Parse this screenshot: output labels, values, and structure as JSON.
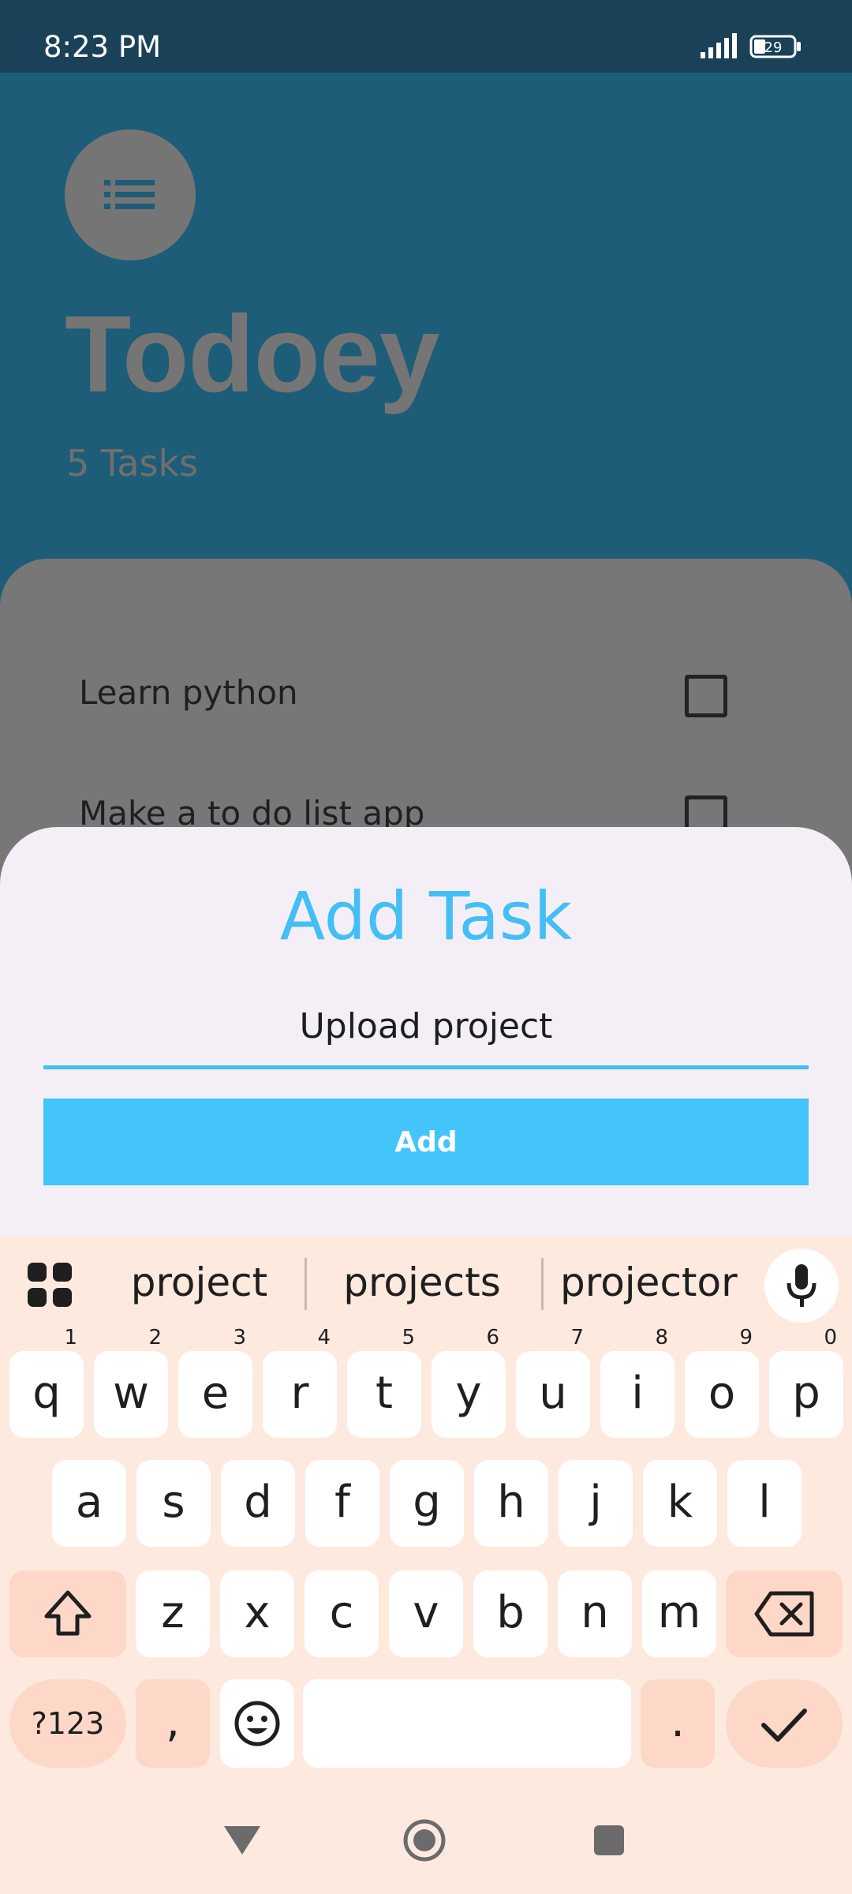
{
  "status_bar": {
    "time": "8:23 PM",
    "battery": "29"
  },
  "app": {
    "title": "Todoey",
    "task_count": "5 Tasks",
    "tasks": [
      "Learn python",
      "Make a to do list app"
    ]
  },
  "sheet": {
    "title": "Add Task",
    "input_value": "Upload project",
    "add_button": "Add"
  },
  "keyboard": {
    "suggestions": [
      "project",
      "projects",
      "projector"
    ],
    "row1": [
      {
        "k": "q",
        "h": "1"
      },
      {
        "k": "w",
        "h": "2"
      },
      {
        "k": "e",
        "h": "3"
      },
      {
        "k": "r",
        "h": "4"
      },
      {
        "k": "t",
        "h": "5"
      },
      {
        "k": "y",
        "h": "6"
      },
      {
        "k": "u",
        "h": "7"
      },
      {
        "k": "i",
        "h": "8"
      },
      {
        "k": "o",
        "h": "9"
      },
      {
        "k": "p",
        "h": "0"
      }
    ],
    "row2": [
      "a",
      "s",
      "d",
      "f",
      "g",
      "h",
      "j",
      "k",
      "l"
    ],
    "row3": [
      "z",
      "x",
      "c",
      "v",
      "b",
      "n",
      "m"
    ],
    "symbols_key": "?123",
    "comma_key": ",",
    "period_key": "."
  },
  "colors": {
    "accent": "#43bff6",
    "status_bar": "#1a4158",
    "app_bg": "#1e5d77",
    "keyboard_bg": "#fee9df"
  }
}
